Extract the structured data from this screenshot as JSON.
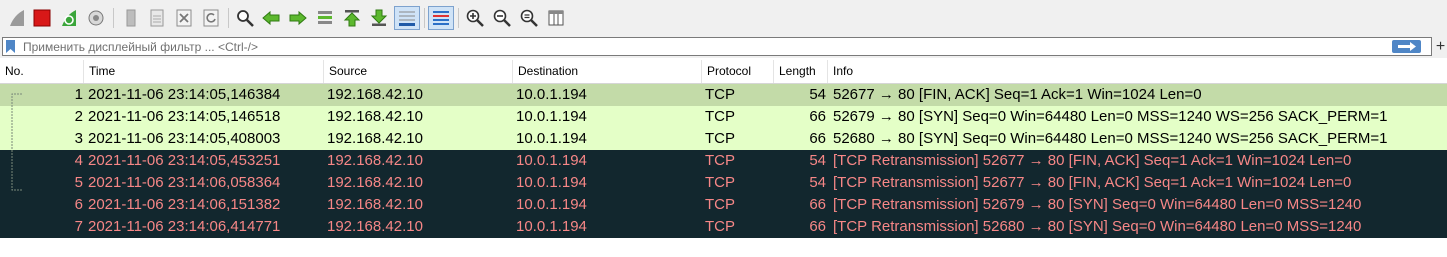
{
  "filter": {
    "placeholder": "Применить дисплейный фильтр ... <Ctrl-/>"
  },
  "toolbar": {
    "icons": [
      "shark-fin-start-icon",
      "stop-capture-icon",
      "restart-capture-icon",
      "capture-options-icon",
      "open-file-icon",
      "save-file-icon",
      "close-file-icon",
      "reload-file-icon",
      "find-packet-icon",
      "go-back-icon",
      "go-forward-icon",
      "go-to-packet-icon",
      "go-first-icon",
      "go-last-icon",
      "autoscroll-icon",
      "colorize-icon",
      "zoom-in-icon",
      "zoom-out-icon",
      "zoom-normal-icon",
      "resize-columns-icon"
    ]
  },
  "columns": [
    "No.",
    "Time",
    "Source",
    "Destination",
    "Protocol",
    "Length",
    "Info"
  ],
  "packets": [
    {
      "no": "1",
      "time": "2021-11-06 23:14:05,146384",
      "src": "192.168.42.10",
      "dst": "10.0.1.194",
      "proto": "TCP",
      "len": "54",
      "info": "52677 → 80 [FIN, ACK] Seq=1 Ack=1 Win=1024 Len=0"
    },
    {
      "no": "2",
      "time": "2021-11-06 23:14:05,146518",
      "src": "192.168.42.10",
      "dst": "10.0.1.194",
      "proto": "TCP",
      "len": "66",
      "info": "52679 → 80 [SYN] Seq=0 Win=64480 Len=0 MSS=1240 WS=256 SACK_PERM=1"
    },
    {
      "no": "3",
      "time": "2021-11-06 23:14:05,408003",
      "src": "192.168.42.10",
      "dst": "10.0.1.194",
      "proto": "TCP",
      "len": "66",
      "info": "52680 → 80 [SYN] Seq=0 Win=64480 Len=0 MSS=1240 WS=256 SACK_PERM=1"
    },
    {
      "no": "4",
      "time": "2021-11-06 23:14:05,453251",
      "src": "192.168.42.10",
      "dst": "10.0.1.194",
      "proto": "TCP",
      "len": "54",
      "info": "[TCP Retransmission] 52677 → 80 [FIN, ACK] Seq=1 Ack=1 Win=1024 Len=0"
    },
    {
      "no": "5",
      "time": "2021-11-06 23:14:06,058364",
      "src": "192.168.42.10",
      "dst": "10.0.1.194",
      "proto": "TCP",
      "len": "54",
      "info": "[TCP Retransmission] 52677 → 80 [FIN, ACK] Seq=1 Ack=1 Win=1024 Len=0"
    },
    {
      "no": "6",
      "time": "2021-11-06 23:14:06,151382",
      "src": "192.168.42.10",
      "dst": "10.0.1.194",
      "proto": "TCP",
      "len": "66",
      "info": "[TCP Retransmission] 52679 → 80 [SYN] Seq=0 Win=64480 Len=0 MSS=1240"
    },
    {
      "no": "7",
      "time": "2021-11-06 23:14:06,414771",
      "src": "192.168.42.10",
      "dst": "10.0.1.194",
      "proto": "TCP",
      "len": "66",
      "info": "[TCP Retransmission] 52680 → 80 [SYN] Seq=0 Win=64480 Len=0 MSS=1240"
    }
  ],
  "colors": {
    "fin_ack_row": "#c3dba8",
    "syn_row": "#e4ffc7",
    "bad_row_bg": "#12272e",
    "bad_row_fg": "#f78787"
  }
}
